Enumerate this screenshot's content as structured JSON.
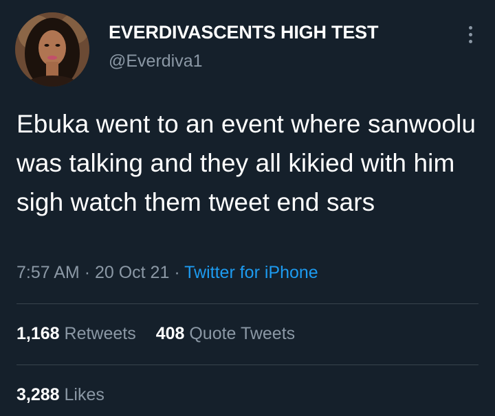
{
  "author": {
    "display_name": "EVERDIVASCENTS HIGH TEST",
    "handle": "@Everdiva1"
  },
  "tweet": {
    "text": "Ebuka went to an event where sanwoolu was talking and they all kikied with him sigh watch them tweet end sars",
    "time": "7:57 AM",
    "separator": "·",
    "date": "20 Oct 21",
    "source": "Twitter for iPhone"
  },
  "stats": {
    "retweets_count": "1,168",
    "retweets_label": "Retweets",
    "quotes_count": "408",
    "quotes_label": "Quote Tweets",
    "likes_count": "3,288",
    "likes_label": "Likes"
  },
  "colors": {
    "background": "#15202b",
    "primary_text": "#ffffff",
    "secondary_text": "#8b98a5",
    "link": "#1d9bf0",
    "divider": "#38444d"
  },
  "icons": {
    "more": "more-options-icon"
  }
}
